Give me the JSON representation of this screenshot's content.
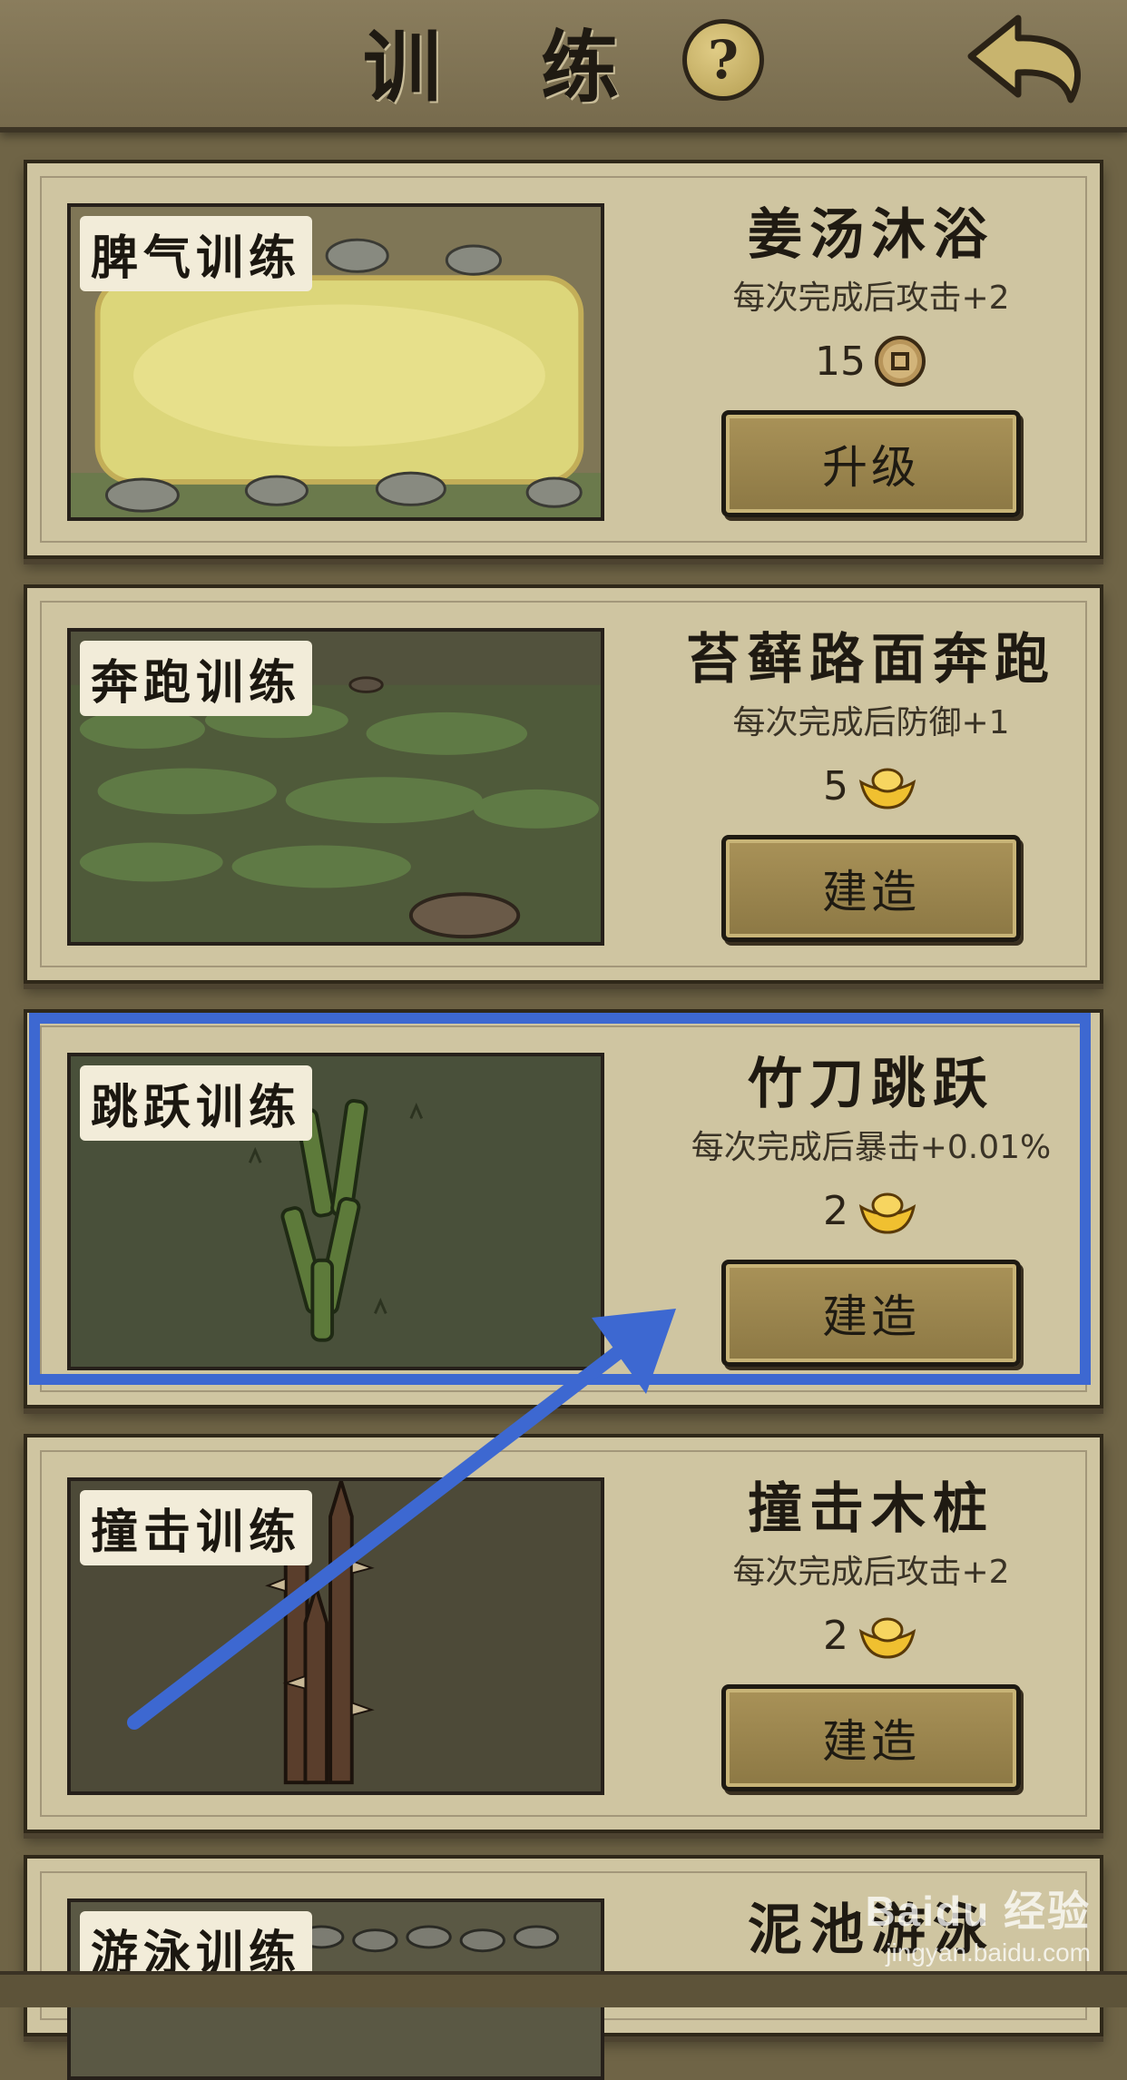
{
  "header": {
    "title": "训 练",
    "help_symbol": "?"
  },
  "cards": [
    {
      "image_label": "脾气训练",
      "name": "姜汤沐浴",
      "effect": "每次完成后攻击+2",
      "cost": "15",
      "currency": "copper-coin-icon",
      "button": "升级"
    },
    {
      "image_label": "奔跑训练",
      "name": "苔藓路面奔跑",
      "effect": "每次完成后防御+1",
      "cost": "5",
      "currency": "gold-ingot-icon",
      "button": "建造"
    },
    {
      "image_label": "跳跃训练",
      "name": "竹刀跳跃",
      "effect": "每次完成后暴击+0.01%",
      "cost": "2",
      "currency": "gold-ingot-icon",
      "button": "建造"
    },
    {
      "image_label": "撞击训练",
      "name": "撞击木桩",
      "effect": "每次完成后攻击+2",
      "cost": "2",
      "currency": "gold-ingot-icon",
      "button": "建造"
    },
    {
      "image_label": "游泳训练",
      "name": "泥池游泳"
    }
  ],
  "watermark": {
    "brand": "Baidu 经验",
    "url": "jingyan.baidu.com"
  },
  "colors": {
    "highlight": "#3d68d1",
    "card_bg": "#cfc5a1",
    "button": "#a99258"
  }
}
